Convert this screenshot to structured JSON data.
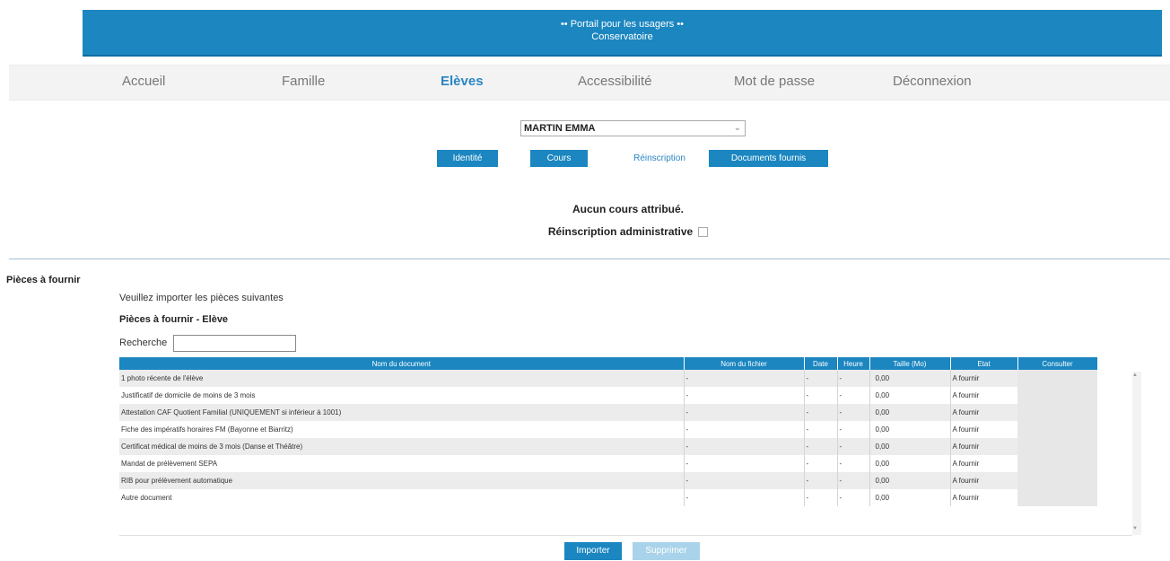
{
  "header": {
    "line1": "•• Portail pour les usagers ••",
    "line2": "Conservatoire"
  },
  "nav": [
    {
      "label": "Accueil",
      "active": false
    },
    {
      "label": "Famille",
      "active": false
    },
    {
      "label": "Elèves",
      "active": true
    },
    {
      "label": "Accessibilité",
      "active": false
    },
    {
      "label": "Mot de passe",
      "active": false
    },
    {
      "label": "Déconnexion",
      "active": false
    }
  ],
  "student_select": {
    "value": "MARTIN EMMA"
  },
  "tabs": [
    {
      "label": "Identité"
    },
    {
      "label": "Cours"
    },
    {
      "label": "Réinscription"
    },
    {
      "label": "Documents fournis"
    }
  ],
  "messages": {
    "no_course": "Aucun cours attribué.",
    "reinscription": "Réinscription administrative"
  },
  "pieces": {
    "section_label": "Pièces à fournir",
    "instruction": "Veuillez importer les pièces suivantes",
    "subtitle": "Pièces à fournir - Elève",
    "search_label": "Recherche",
    "search_value": ""
  },
  "table": {
    "headers": [
      "Nom du document",
      "Nom du fichier",
      "Date",
      "Heure",
      "Taille (Mo)",
      "Etat",
      "Consulter"
    ],
    "rows": [
      {
        "doc": "1 photo récente de l'élève",
        "file": "-",
        "date": "-",
        "time": "-",
        "size": "0,00",
        "status": "A fournir"
      },
      {
        "doc": "Justificatif de domicile de moins de 3 mois",
        "file": "-",
        "date": "-",
        "time": "-",
        "size": "0,00",
        "status": "A fournir"
      },
      {
        "doc": "Attestation CAF Quotient Familial (UNIQUEMENT si inférieur à 1001)",
        "file": "-",
        "date": "-",
        "time": "-",
        "size": "0,00",
        "status": "A fournir"
      },
      {
        "doc": "Fiche des impératifs horaires FM (Bayonne et Biarritz)",
        "file": "-",
        "date": "-",
        "time": "-",
        "size": "0,00",
        "status": "A fournir"
      },
      {
        "doc": "Certificat médical de moins de 3 mois (Danse et Théâtre)",
        "file": "-",
        "date": "-",
        "time": "-",
        "size": "0,00",
        "status": "A fournir"
      },
      {
        "doc": "Mandat de prélèvement SEPA",
        "file": "-",
        "date": "-",
        "time": "-",
        "size": "0,00",
        "status": "A fournir"
      },
      {
        "doc": "RIB pour prélèvement automatique",
        "file": "-",
        "date": "-",
        "time": "-",
        "size": "0,00",
        "status": "A fournir"
      },
      {
        "doc": "Autre document",
        "file": "-",
        "date": "-",
        "time": "-",
        "size": "0,00",
        "status": "A fournir"
      }
    ]
  },
  "actions": {
    "import_label": "Importer",
    "delete_label": "Supprimer"
  },
  "colors": {
    "primary": "#1b86c0",
    "disabled": "#a9d3ea",
    "nav_bg": "#f3f3f3"
  }
}
